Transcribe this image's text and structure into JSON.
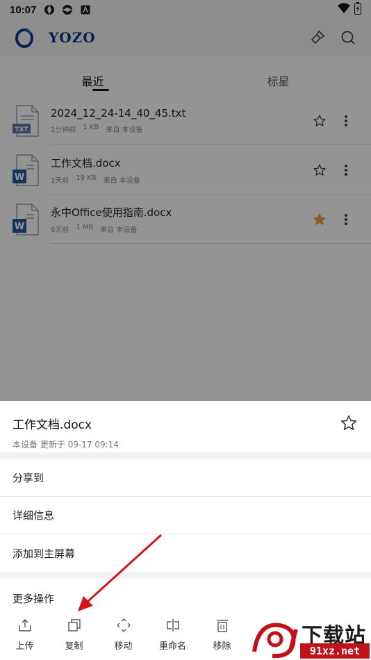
{
  "status_bar": {
    "time": "10:07",
    "icons": [
      "aperture-icon",
      "aperture-icon",
      "a-badge-icon"
    ],
    "right_icons": [
      "wifi-icon",
      "battery-charging-icon"
    ]
  },
  "app_bar": {
    "brand": "YOZO",
    "logo_icon": "yozo-logo-icon",
    "actions": [
      "clean-brush-icon",
      "search-icon"
    ]
  },
  "tabs": [
    {
      "label": "最近",
      "active": true
    },
    {
      "label": "标星",
      "active": false
    }
  ],
  "files": [
    {
      "name": "2024_12_24-14_40_45.txt",
      "time": "1分钟前",
      "size": "1 KB",
      "source": "来自 本设备",
      "type": "TXT",
      "starred": false
    },
    {
      "name": "工作文档.docx",
      "time": "1天前",
      "size": "19 KB",
      "source": "来自 本设备",
      "type": "W",
      "starred": false
    },
    {
      "name": "永中Office使用指南.docx",
      "time": "6天前",
      "size": "1 MB",
      "source": "来自 本设备",
      "type": "W",
      "starred": true
    }
  ],
  "sheet": {
    "title": "工作文档.docx",
    "subtitle": "本设备 更新于 09-17 09:14",
    "menu": [
      "分享到",
      "详细信息",
      "添加到主屏幕"
    ],
    "more_title": "更多操作",
    "tools": [
      {
        "label": "上传",
        "icon": "upload-icon"
      },
      {
        "label": "复制",
        "icon": "copy-icon"
      },
      {
        "label": "移动",
        "icon": "move-icon"
      },
      {
        "label": "重命名",
        "icon": "rename-icon"
      },
      {
        "label": "移除",
        "icon": "delete-icon"
      }
    ]
  },
  "watermark": {
    "text": "下载站",
    "url": "91xz.net"
  },
  "colors": {
    "brand": "#0d3a8a",
    "star_active": "#e8a43a",
    "word_blue": "#2b579a",
    "arrow": "#d0141d"
  }
}
